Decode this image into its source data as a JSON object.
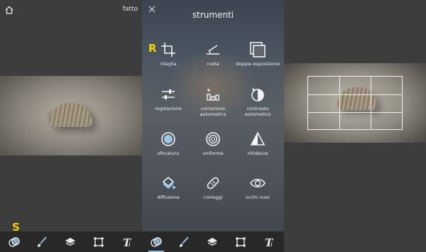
{
  "left_panel": {
    "done_label": "fatto",
    "marker_label": "S"
  },
  "tools_panel": {
    "title": "strumenti",
    "marker_label": "R",
    "tools": [
      {
        "label": "ritaglia",
        "icon": "crop-icon"
      },
      {
        "label": "ruota",
        "icon": "rotate-icon"
      },
      {
        "label": "doppia esposizione",
        "icon": "double-exposure-icon"
      },
      {
        "label": "regolazione",
        "icon": "adjust-sliders-icon"
      },
      {
        "label": "correzione automatica",
        "icon": "auto-correct-icon"
      },
      {
        "label": "contrasto automatico",
        "icon": "auto-contrast-icon"
      },
      {
        "label": "sfocatura",
        "icon": "blur-icon"
      },
      {
        "label": "uniforme",
        "icon": "smooth-icon"
      },
      {
        "label": "nitidezza",
        "icon": "sharpen-icon"
      },
      {
        "label": "diffusione",
        "icon": "diffusion-icon"
      },
      {
        "label": "correggi",
        "icon": "heal-icon"
      },
      {
        "label": "occhi rossi",
        "icon": "red-eye-icon"
      }
    ]
  },
  "bottom_toolbar": [
    {
      "icon": "filters-icon"
    },
    {
      "icon": "brush-icon"
    },
    {
      "icon": "layers-icon"
    },
    {
      "icon": "transform-icon"
    },
    {
      "icon": "text-icon"
    }
  ],
  "colors": {
    "accent": "#7fb8e0",
    "marker": "#f5d400",
    "toolbar": "#282828"
  }
}
